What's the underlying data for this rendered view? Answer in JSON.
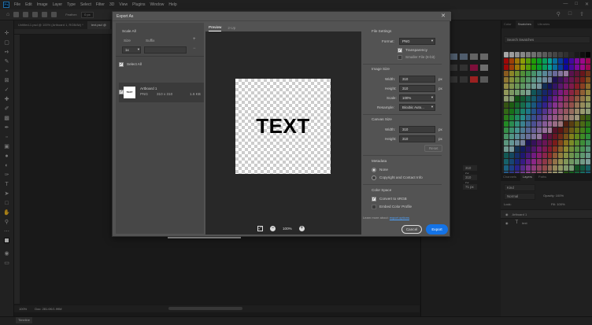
{
  "menubar": {
    "app_badge": "Ps",
    "items": [
      "File",
      "Edit",
      "Image",
      "Layer",
      "Type",
      "Select",
      "Filter",
      "3D",
      "View",
      "Plugins",
      "Window",
      "Help"
    ],
    "window_controls": [
      "—",
      "□",
      "✕"
    ]
  },
  "options": {
    "feather_label": "Feather:",
    "feather_value": "0 px"
  },
  "doc_tabs": [
    {
      "label": "Untitled-1.psd @ 100% (Artboard 1, RGB/8#) *"
    },
    {
      "label": "text.psd @"
    }
  ],
  "status": {
    "zoom": "100%",
    "doc_info": "Doc: 281.6K/1.99M"
  },
  "timeline_button": "Timeline",
  "dialog": {
    "title": "Export As",
    "close": "✕",
    "scale_all": "Scale All",
    "size_label": "Size",
    "suffix_label": "Suffix",
    "size_value": "1x",
    "select_all": "Select All",
    "asset": {
      "thumb_text": "TEXT",
      "name": "Artboard 1",
      "format": "PNG",
      "dims": "310 x 310",
      "filesize": "1.6 KB"
    },
    "preview_tabs": [
      "Preview",
      "2-Up"
    ],
    "preview_text": "TEXT",
    "zoom_value": "100%",
    "file_settings": {
      "heading": "File Settings",
      "format_label": "Format:",
      "format_value": "PNG",
      "transparency": "Transparency",
      "smaller_file": "Smaller File (8-bit)"
    },
    "image_size": {
      "heading": "Image Size",
      "width_label": "Width:",
      "width_value": "310",
      "height_label": "Height:",
      "height_value": "310",
      "scale_label": "Scale:",
      "scale_value": "100%",
      "resample_label": "Resample:",
      "resample_value": "Bicubic Auto...",
      "unit": "px"
    },
    "canvas_size": {
      "heading": "Canvas Size",
      "width_label": "Width:",
      "width_value": "310",
      "height_label": "Height:",
      "height_value": "310",
      "reset": "Reset",
      "unit": "px"
    },
    "metadata": {
      "heading": "Metadata",
      "none": "None",
      "copyright": "Copyright and Contact Info"
    },
    "color_space": {
      "heading": "Color Space",
      "convert": "Convert to sRGB",
      "embed": "Embed Color Profile"
    },
    "learn_more": "Learn more about:",
    "learn_link": "export options",
    "cancel": "Cancel",
    "export": "Export"
  },
  "right_panel": {
    "tabs": [
      "Color",
      "Swatches",
      "Libraries"
    ],
    "search_placeholder": "Search Swatches"
  },
  "layers_panel": {
    "tabs": [
      "Channels",
      "Layers",
      "Paths"
    ],
    "kind": "Kind",
    "mode": "Normal",
    "opacity": "Opacity: 100%",
    "lock": "Lock:",
    "fill": "Fill: 100%",
    "layers": [
      {
        "name": "Artboard 1"
      },
      {
        "name": "text"
      }
    ]
  },
  "mid_panel": {
    "field1": "310 px",
    "field2": "310 px",
    "field3": "71 px"
  }
}
